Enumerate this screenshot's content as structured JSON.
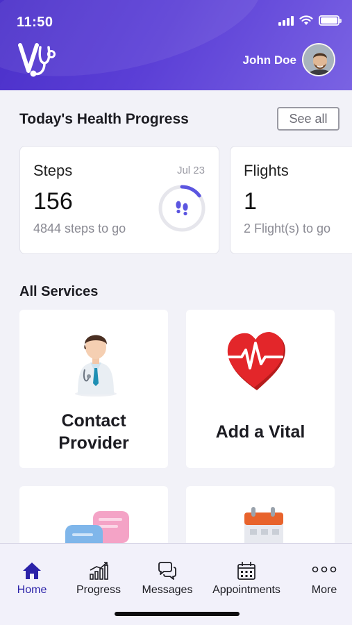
{
  "status_bar": {
    "time": "11:50"
  },
  "header": {
    "user_name": "John Doe"
  },
  "health_progress": {
    "title": "Today's Health Progress",
    "see_all_label": "See all",
    "cards": [
      {
        "label": "Steps",
        "date": "Jul 23",
        "value": "156",
        "sub": "4844 steps to go",
        "progress": 0.031
      },
      {
        "label": "Flights",
        "value": "1",
        "sub": "2 Flight(s) to go"
      }
    ]
  },
  "services": {
    "title": "All Services",
    "items": [
      {
        "label_line1": "Contact",
        "label_line2": "Provider"
      },
      {
        "label": "Add a Vital"
      }
    ]
  },
  "tab_bar": {
    "active": "Home",
    "tabs": [
      {
        "label": "Home",
        "icon": "home-icon"
      },
      {
        "label": "Progress",
        "icon": "bar-chart-icon"
      },
      {
        "label": "Messages",
        "icon": "chat-bubbles-icon"
      },
      {
        "label": "Appointments",
        "icon": "calendar-icon"
      },
      {
        "label": "More",
        "icon": "more-dots-icon"
      }
    ]
  },
  "colors": {
    "primary": "#4a2fc9",
    "active_tab": "#2b22a8",
    "ring": "#5b55e0"
  }
}
